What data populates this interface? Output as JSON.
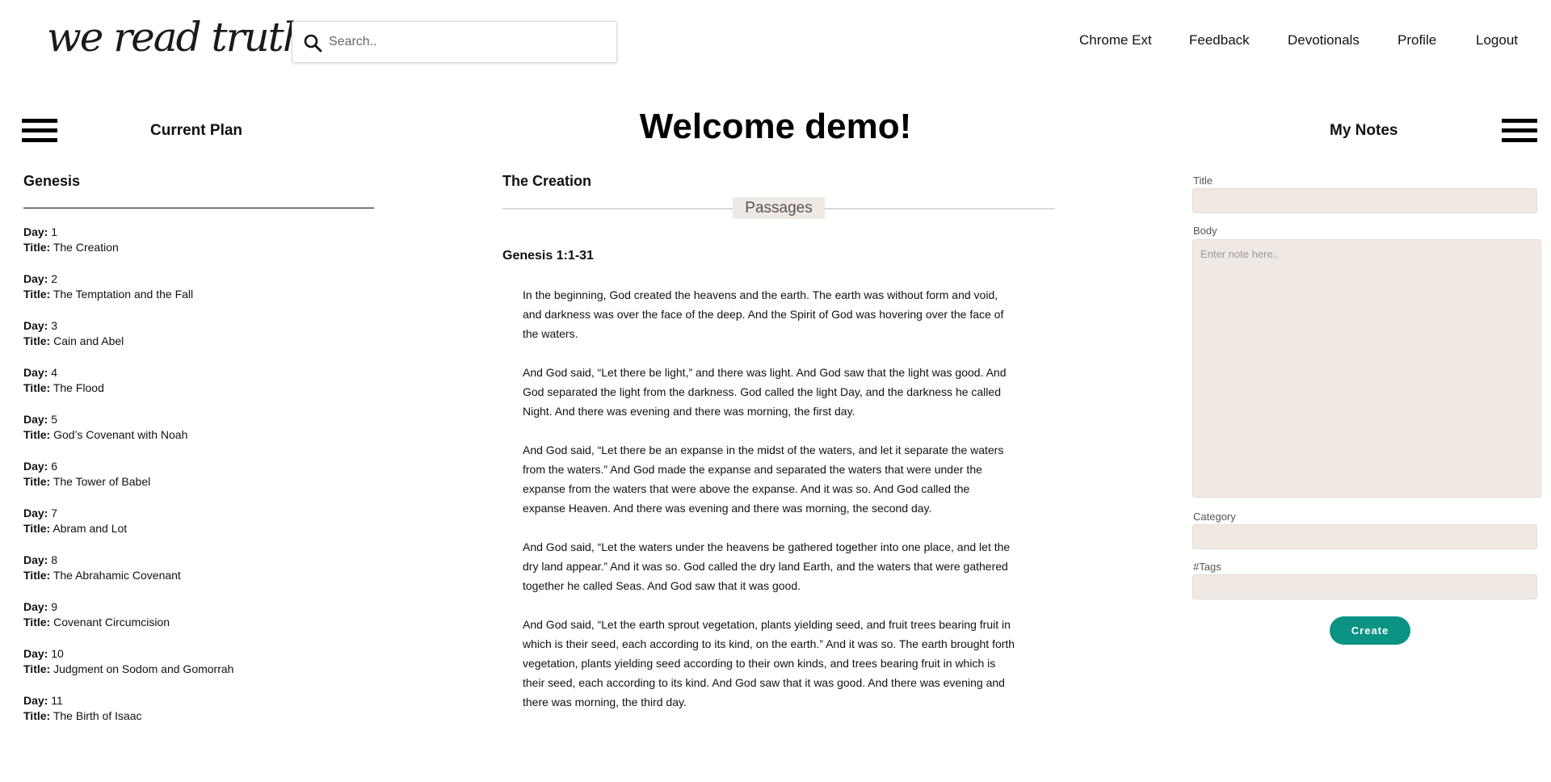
{
  "brand": {
    "logo_text": "we read truth"
  },
  "search": {
    "placeholder": "Search.."
  },
  "nav": {
    "items": [
      {
        "label": "Chrome Ext"
      },
      {
        "label": "Feedback"
      },
      {
        "label": "Devotionals"
      },
      {
        "label": "Profile"
      },
      {
        "label": "Logout"
      }
    ]
  },
  "header": {
    "left_title": "Current Plan",
    "welcome": "Welcome demo!",
    "right_title": "My Notes"
  },
  "plan": {
    "book": "Genesis",
    "day_label": "Day:",
    "title_label": "Title:",
    "days": [
      {
        "day": "1",
        "title": "The Creation"
      },
      {
        "day": "2",
        "title": "The Temptation and the Fall"
      },
      {
        "day": "3",
        "title": "Cain and Abel"
      },
      {
        "day": "4",
        "title": "The Flood"
      },
      {
        "day": "5",
        "title": "God’s Covenant with Noah"
      },
      {
        "day": "6",
        "title": "The Tower of Babel"
      },
      {
        "day": "7",
        "title": "Abram and Lot"
      },
      {
        "day": "8",
        "title": "The Abrahamic Covenant"
      },
      {
        "day": "9",
        "title": "Covenant Circumcision"
      },
      {
        "day": "10",
        "title": "Judgment on Sodom and Gomorrah"
      },
      {
        "day": "11",
        "title": "The Birth of Isaac"
      }
    ]
  },
  "reading": {
    "title": "The Creation",
    "tab_label": "Passages",
    "reference": "Genesis 1:1-31",
    "paragraphs": [
      "In the beginning, God created the heavens and the earth. The earth was without form and void, and darkness was over the face of the deep. And the Spirit of God was hovering over the face of the waters.",
      "And God said, “Let there be light,” and there was light. And God saw that the light was good. And God separated the light from the darkness. God called the light Day, and the darkness he called Night. And there was evening and there was morning, the first day.",
      "And God said, “Let there be an expanse in the midst of the waters, and let it separate the waters from the waters.” And God made the expanse and separated the waters that were under the expanse from the waters that were above the expanse. And it was so. And God called the expanse Heaven. And there was evening and there was morning, the second day.",
      "And God said, “Let the waters under the heavens be gathered together into one place, and let the dry land appear.” And it was so. God called the dry land Earth, and the waters that were gathered together he called Seas. And God saw that it was good.",
      "And God said, “Let the earth sprout vegetation, plants yielding seed, and fruit trees bearing fruit in which is their seed, each according to its kind, on the earth.” And it was so. The earth brought forth vegetation, plants yielding seed according to their own kinds, and trees bearing fruit in which is their seed, each according to its kind. And God saw that it was good. And there was evening and there was morning, the third day."
    ]
  },
  "notes": {
    "title_label": "Title",
    "title_value": "",
    "body_label": "Body",
    "body_placeholder": "Enter note here..",
    "category_label": "Category",
    "category_value": "",
    "tags_label": "#Tags",
    "tags_value": "",
    "create_label": "Create"
  },
  "colors": {
    "accent": "#0b9384",
    "field_bg": "#f0e8e2"
  }
}
